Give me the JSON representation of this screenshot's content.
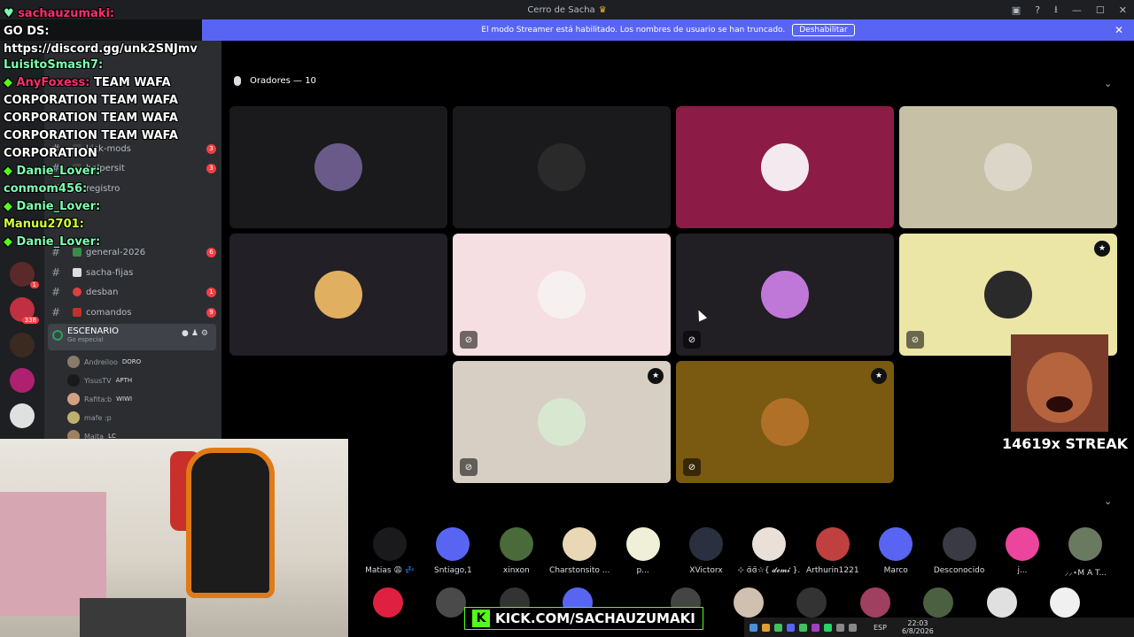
{
  "window": {
    "title": "Cerro de Sacha"
  },
  "streamer_banner": {
    "text": "El modo Streamer está habilitado. Los nombres de usuario se han truncado.",
    "button": "Deshabilitar"
  },
  "server_rail": {
    "badges": [
      "1",
      "338"
    ]
  },
  "channels": [
    {
      "label": "kick-mods",
      "count": "3"
    },
    {
      "label": "helpersit",
      "count": "3"
    },
    {
      "label": "registro",
      "count": ""
    },
    {
      "label": "general-2026",
      "count": "6"
    },
    {
      "label": "sacha-fijas",
      "count": ""
    },
    {
      "label": "desban",
      "count": "1"
    },
    {
      "label": "comandos",
      "count": "9"
    }
  ],
  "stage_channel": {
    "name": "ESCENARIO",
    "subtitle": "Go especial"
  },
  "stage_members": [
    {
      "name": "Andreiloo",
      "tag": "DORO"
    },
    {
      "name": "YisusTV",
      "tag": "APTH"
    },
    {
      "name": "Rafita:b",
      "tag": "WIWI"
    },
    {
      "name": "mafe :p",
      "tag": ""
    },
    {
      "name": "Maita",
      "tag": "LC"
    }
  ],
  "stage": {
    "speakers_header": "Oradores — 10"
  },
  "speaker_tiles": [
    {
      "bg": "#1a1a1c",
      "avatar": "#6a5a8a",
      "muted": false,
      "mod": false
    },
    {
      "bg": "#1a1a1c",
      "avatar": "#2a2a2a",
      "muted": false,
      "mod": false
    },
    {
      "bg": "#8c1b45",
      "avatar": "#f4e9ee",
      "muted": false,
      "mod": false
    },
    {
      "bg": "#c5c0a6",
      "avatar": "#dcd6c8",
      "muted": false,
      "mod": false
    },
    {
      "bg": "#231f26",
      "avatar": "#e0b060",
      "muted": false,
      "mod": false
    },
    {
      "bg": "#f5dfe3",
      "avatar": "#f7f0f0",
      "muted": true,
      "mod": false
    },
    {
      "bg": "#211e24",
      "avatar": "#c078d8",
      "muted": true,
      "mod": false
    },
    {
      "bg": "#ebe6a6",
      "avatar": "#2a2a2a",
      "muted": true,
      "mod": true
    },
    {
      "bg": "#d7cfc4",
      "avatar": "#d8e8d0",
      "muted": true,
      "mod": true
    },
    {
      "bg": "#7a5a10",
      "avatar": "#b07028",
      "muted": true,
      "mod": true
    }
  ],
  "audience": [
    {
      "name": "Matias 😩 💤",
      "color": "#1a1a1c"
    },
    {
      "name": "Sntiago,1",
      "color": "#5865f2"
    },
    {
      "name": "xinxon",
      "color": "#4a6a3a"
    },
    {
      "name": "Charstonsito ...",
      "color": "#e9d7b5"
    },
    {
      "name": "p...",
      "color": "#f0f0d8"
    },
    {
      "name": "XVictorx",
      "color": "#2a3040"
    },
    {
      "name": "⊹ ɞ̈ɞ̈☆{ 𝓭𝓮𝓶𝓲 }...",
      "color": "#eae0d8"
    },
    {
      "name": "Arthurin1221",
      "color": "#c04040"
    },
    {
      "name": "Marco",
      "color": "#5865f2"
    },
    {
      "name": "Desconocido",
      "color": "#3a3a44"
    },
    {
      "name": "j...",
      "color": "#eb459e"
    },
    {
      "name": "⸝⸝⋆M A T...",
      "color": "#6a7a60"
    }
  ],
  "chat": [
    {
      "user": "sachauzumaki:",
      "text": "",
      "ucolor": "u-pink"
    },
    {
      "user": "GO DS:",
      "text": "",
      "ucolor": "t-white"
    },
    {
      "user": "https://discord.gg/unk2SNJmv",
      "text": "",
      "ucolor": "t-white"
    },
    {
      "user": "LuisitoSmash7:",
      "text": "",
      "ucolor": "u-green"
    },
    {
      "user": "AnyFoxess:",
      "text": " TEAM WAFA",
      "ucolor": "u-pink"
    },
    {
      "user": "CORPORATION",
      "text": " TEAM WAFA",
      "ucolor": "t-white"
    },
    {
      "user": "CORPORATION",
      "text": " TEAM WAFA",
      "ucolor": "t-white"
    },
    {
      "user": "CORPORATION",
      "text": " TEAM WAFA",
      "ucolor": "t-white"
    },
    {
      "user": "CORPORATION",
      "text": "",
      "ucolor": "t-white"
    },
    {
      "user": "Danie_Lover:",
      "text": "",
      "ucolor": "u-green"
    },
    {
      "user": "conmom456:",
      "text": "",
      "ucolor": "u-green"
    },
    {
      "user": "Danie_Lover:",
      "text": "",
      "ucolor": "u-green"
    },
    {
      "user": "Manuu2701:",
      "text": "",
      "ucolor": "u-yellow"
    },
    {
      "user": "Danie_Lover:",
      "text": "",
      "ucolor": "u-green"
    }
  ],
  "overlay": {
    "kick_url": "KICK.COM/SACHAUZUMAKI",
    "streak": "14619x STREAK"
  },
  "taskbar": {
    "lang": "ESP",
    "time": "22:03",
    "date": "6/8/2026"
  }
}
